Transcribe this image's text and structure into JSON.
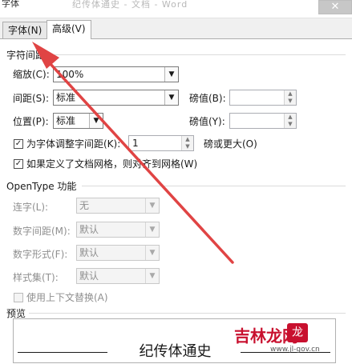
{
  "window": {
    "title": "字体",
    "title_blur": "纪传体通史 - 文档 - Word",
    "close": "✕"
  },
  "tabs": [
    {
      "label": "字体(N)"
    },
    {
      "label": "高级(V)"
    }
  ],
  "spacing": {
    "title": "字符间距",
    "scale_label": "缩放(C):",
    "scale_value": "100%",
    "spacing_label": "间距(S):",
    "spacing_value": "标准",
    "spacing_pt_label": "磅值(B):",
    "spacing_pt_value": "",
    "position_label": "位置(P):",
    "position_value": "标准",
    "position_pt_label": "磅值(Y):",
    "position_pt_value": "",
    "kerning_label": "为字体调整字间距(K):",
    "kerning_checked": true,
    "kerning_value": "1",
    "kerning_suffix": "磅或更大(O)",
    "grid_label": "如果定义了文档网格，则对齐到网格(W)",
    "grid_checked": true
  },
  "opentype": {
    "title": "OpenType 功能",
    "ligatures_label": "连字(L):",
    "ligatures_value": "无",
    "num_spacing_label": "数字间距(M):",
    "num_spacing_value": "默认",
    "num_forms_label": "数字形式(F):",
    "num_forms_value": "默认",
    "stylistic_label": "样式集(T):",
    "stylistic_value": "默认",
    "contextual_label": "使用上下文替换(A)",
    "contextual_checked": false
  },
  "preview": {
    "title": "预览",
    "text": "纪传体通史"
  },
  "watermark": {
    "text": "吉林龙网",
    "logo": "龙",
    "url": "www.jl-gov.cn"
  },
  "annotation": {
    "arrow_color": "#e04444"
  }
}
